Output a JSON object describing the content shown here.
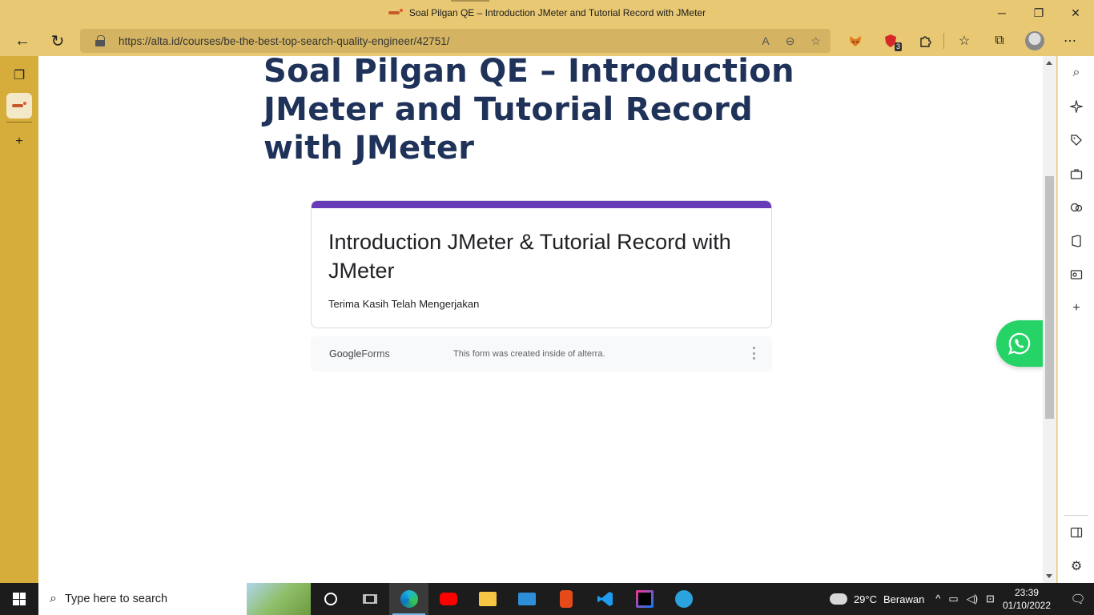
{
  "window": {
    "title": "Soal Pilgan QE – Introduction JMeter and Tutorial Record with JMeter",
    "minimize": "─",
    "restore": "❐",
    "close": "✕"
  },
  "toolbar": {
    "back": "←",
    "refresh": "↻",
    "url": "https://alta.id/courses/be-the-best-top-search-quality-engineer/42751/",
    "read_aloud": "A",
    "zoom_out": "⊖",
    "add_favorite": "☆",
    "extension_badge": "3",
    "favorites": "☆",
    "collections": "⧉",
    "more": "⋯"
  },
  "vtabs": {
    "actions": "❐",
    "new_tab": "+"
  },
  "page": {
    "heading": "Soal Pilgan QE – Introduction JMeter and Tutorial Record with JMeter",
    "form": {
      "title": "Introduction JMeter & Tutorial Record with JMeter",
      "message": "Terima Kasih Telah Mengerjakan",
      "footer_brand_google": "Google",
      "footer_brand_forms": "Forms",
      "footer_note": "This form was created inside of alterra."
    }
  },
  "sidebar": {
    "search": "⌕",
    "add": "+",
    "settings": "⚙"
  },
  "taskbar": {
    "search_placeholder": "Type here to search",
    "temperature": "29°C",
    "weather": "Berawan",
    "time": "23:39",
    "date": "01/10/2022",
    "tray_arrow": "^",
    "notifications": "🗨"
  },
  "colors": {
    "frame": "#e8c873",
    "vertical_tabs": "#d6ad3a",
    "heading": "#1f3259",
    "form_accent": "#673ab7",
    "whatsapp": "#25d366"
  }
}
